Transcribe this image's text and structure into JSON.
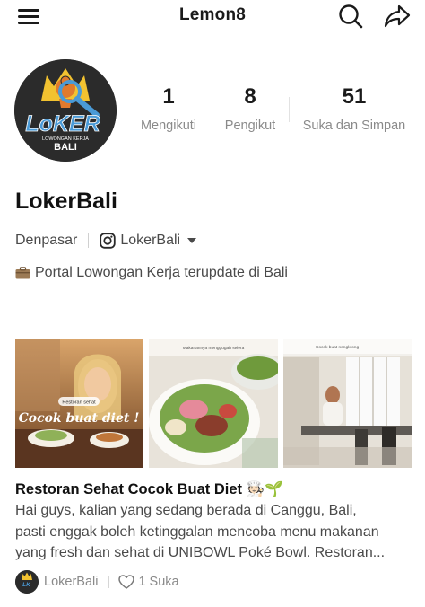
{
  "app": {
    "title": "Lemon8"
  },
  "profile": {
    "name": "LokerBali",
    "avatar_text": {
      "line1": "LoKER",
      "line2": "LOWONGAN KERJA",
      "line3": "BALI"
    },
    "location": "Denpasar",
    "instagram": "LokerBali",
    "bio": "Portal Lowongan Kerja terupdate di Bali",
    "stats": [
      {
        "value": "1",
        "label": "Mengikuti"
      },
      {
        "value": "8",
        "label": "Pengikut"
      },
      {
        "value": "51",
        "label": "Suka dan Simpan"
      }
    ]
  },
  "post": {
    "images": [
      {
        "tag": "Restoran sehat",
        "caption": "Cocok buat diet !"
      },
      {
        "caption": "Makanannya menggugah selera"
      },
      {
        "caption": "Cocok buat nongkrong"
      }
    ],
    "title": "Restoran Sehat Cocok Buat Diet 🧑🏻‍🍳🌱",
    "body_lines": [
      "Hai guys, kalian yang sedang berada di Canggu, Bali,",
      "pasti enggak boleh ketinggalan mencoba menu makanan",
      "yang fresh dan sehat di UNIBOWL Poké Bowl. Restoran..."
    ],
    "author": "LokerBali",
    "likes": "1 Suka"
  },
  "icons": {
    "menu": "hamburger-menu-icon",
    "search": "search-icon",
    "share": "share-icon",
    "instagram": "instagram-icon",
    "bio": "briefcase-icon",
    "like": "heart-icon"
  },
  "colors": {
    "text": "#1a1a1a",
    "muted": "#8a8a8a",
    "secondary": "#4a4a4a",
    "avatar_bg": "#2b2b2b",
    "avatar_yellow": "#f2c230",
    "avatar_blue": "#4a9ad6"
  }
}
